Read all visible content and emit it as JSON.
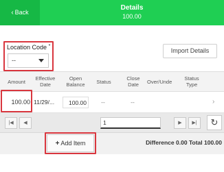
{
  "header": {
    "back_label": "Back",
    "title": "Details",
    "subtitle": "100.00",
    "color": "#1fcf53"
  },
  "form": {
    "location_code_label": "Location Code",
    "required_marker": "*",
    "location_code_value": "--",
    "import_details_label": "Import Details"
  },
  "grid": {
    "columns": [
      "Amount",
      "Effective\nDate",
      "Open\nBalance",
      "Status",
      "Close\nDate",
      "Over/Unde",
      "Status\nType"
    ],
    "rows": [
      {
        "amount": "100.00",
        "effective_date": "11/29/...",
        "open_balance": "100.00",
        "status": "--",
        "close_date": "--"
      }
    ]
  },
  "pager": {
    "first_icon": "first-page-icon",
    "prev_icon": "prev-page-icon",
    "next_icon": "next-page-icon",
    "last_icon": "last-page-icon",
    "page_value": "1",
    "refresh_icon": "refresh-icon"
  },
  "footer": {
    "add_item_label": "Add Item",
    "difference_label": "Difference",
    "difference_value": "0.00",
    "total_label": "Total",
    "total_value": "100.00"
  },
  "accent_color": "#d9363e"
}
